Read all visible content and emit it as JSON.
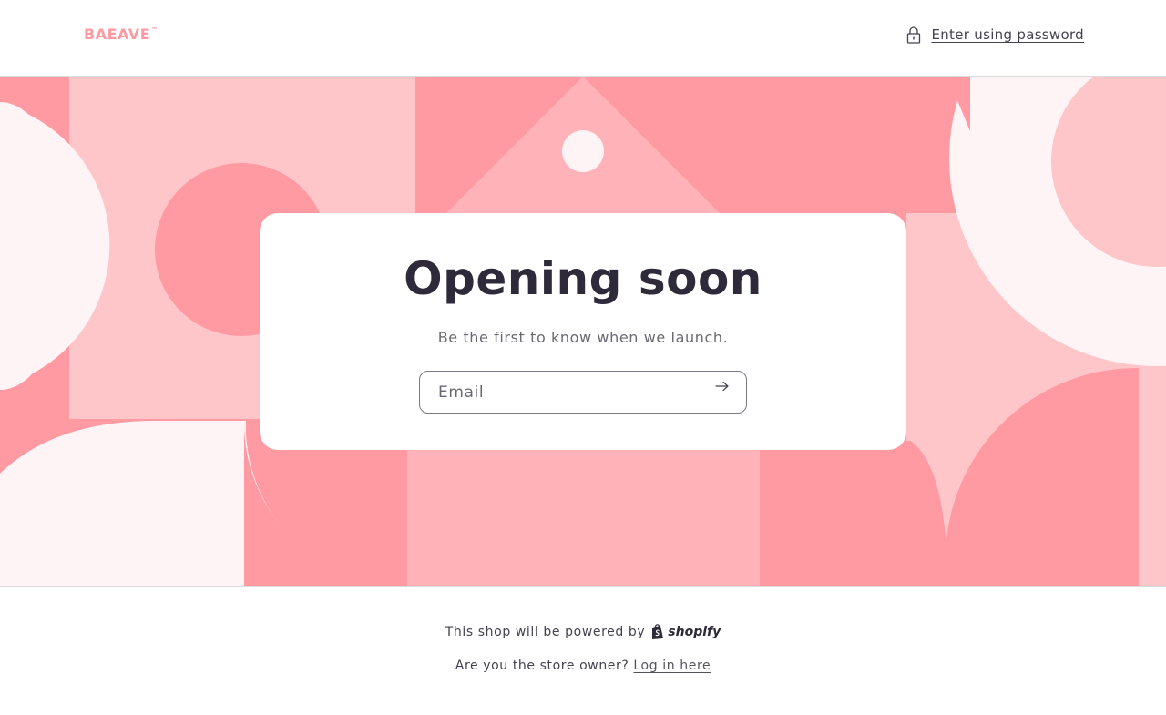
{
  "header": {
    "logo_text": "BAEAVE",
    "logo_mark": "™",
    "password_link": "Enter using password",
    "lock_icon": "lock-icon"
  },
  "hero": {
    "title": "Opening soon",
    "subtitle": "Be the first to know when we launch.",
    "email_placeholder": "Email",
    "submit_icon": "arrow-right-icon"
  },
  "footer": {
    "powered_text": "This shop will be powered by",
    "shopify_text": "shopify",
    "owner_question": "Are you the store owner?",
    "login_link": "Log in here"
  },
  "colors": {
    "brand": "#ff9aa2",
    "pink_dark": "#ff9aa2",
    "pink_mid": "#ffb3b9",
    "pink_light": "#ffc6ca",
    "pink_pale": "#fff4f5",
    "text_dark": "#2e2a39"
  }
}
